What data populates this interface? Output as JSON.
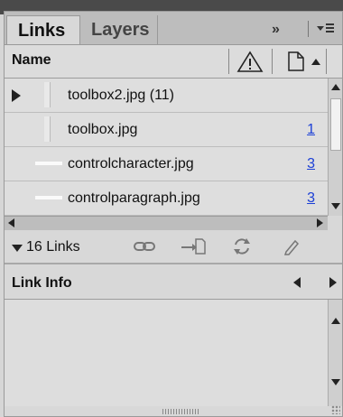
{
  "tabs": {
    "links": "Links",
    "layers": "Layers"
  },
  "tabbar": {
    "forward_glyph": "»",
    "menu_glyph": "≡"
  },
  "columns": {
    "name": "Name"
  },
  "rows": [
    {
      "label": "toolbox2.jpg (11)",
      "count": ""
    },
    {
      "label": "toolbox.jpg",
      "count": "1"
    },
    {
      "label": "controlcharacter.jpg",
      "count": "3"
    },
    {
      "label": "controlparagraph.jpg",
      "count": "3"
    }
  ],
  "linkbar": {
    "count_label": "16 Links"
  },
  "info": {
    "title": "Link Info"
  },
  "colors": {
    "link_count": "#1b3fd6",
    "panel_bg": "#d8d8d8",
    "tabbar_bg": "#bdbdbd"
  },
  "icons": [
    "warning-icon",
    "page-icon",
    "chain-link-icon",
    "goto-link-icon",
    "relink-icon",
    "edit-original-icon"
  ]
}
